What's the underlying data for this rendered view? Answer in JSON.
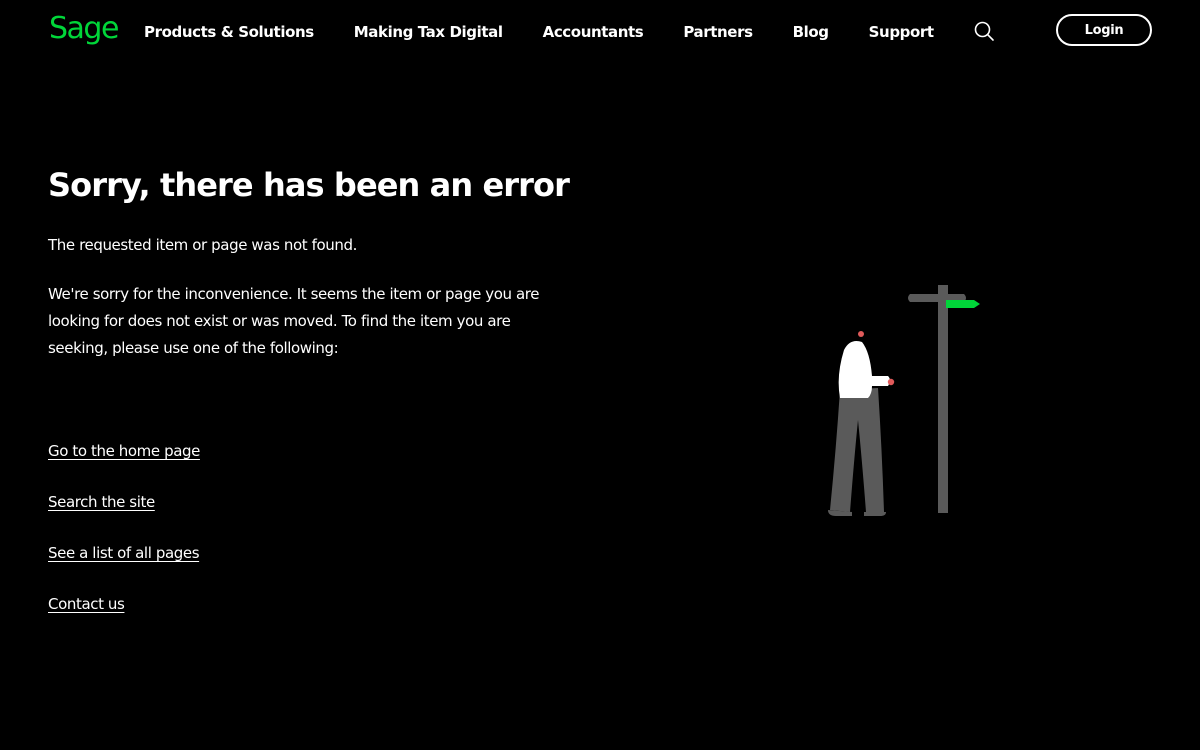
{
  "header": {
    "logo_text": "Sage",
    "nav_items": [
      {
        "label": "Products & Solutions"
      },
      {
        "label": "Making Tax Digital"
      },
      {
        "label": "Accountants"
      },
      {
        "label": "Partners"
      },
      {
        "label": "Blog"
      },
      {
        "label": "Support"
      }
    ],
    "search_icon": "search-icon",
    "login_label": "Login"
  },
  "main": {
    "title": "Sorry, there has been an error",
    "message": "The requested item or page was not found.",
    "description": "We're sorry for the inconvenience. It seems the item or page you are looking for does not exist or was moved. To find the item you are seeking, please use one of the following:",
    "links": [
      {
        "label": "Go to the home page"
      },
      {
        "label": "Search the site"
      },
      {
        "label": "See a list of all pages"
      },
      {
        "label": "Contact us"
      }
    ]
  },
  "illustration": {
    "icon": "person-at-signpost-illustration"
  },
  "colors": {
    "background": "#000000",
    "text": "#ffffff",
    "brand_green": "#00d639",
    "signpost_grey": "#5a5a5a",
    "accent_red": "#e05a5a"
  }
}
